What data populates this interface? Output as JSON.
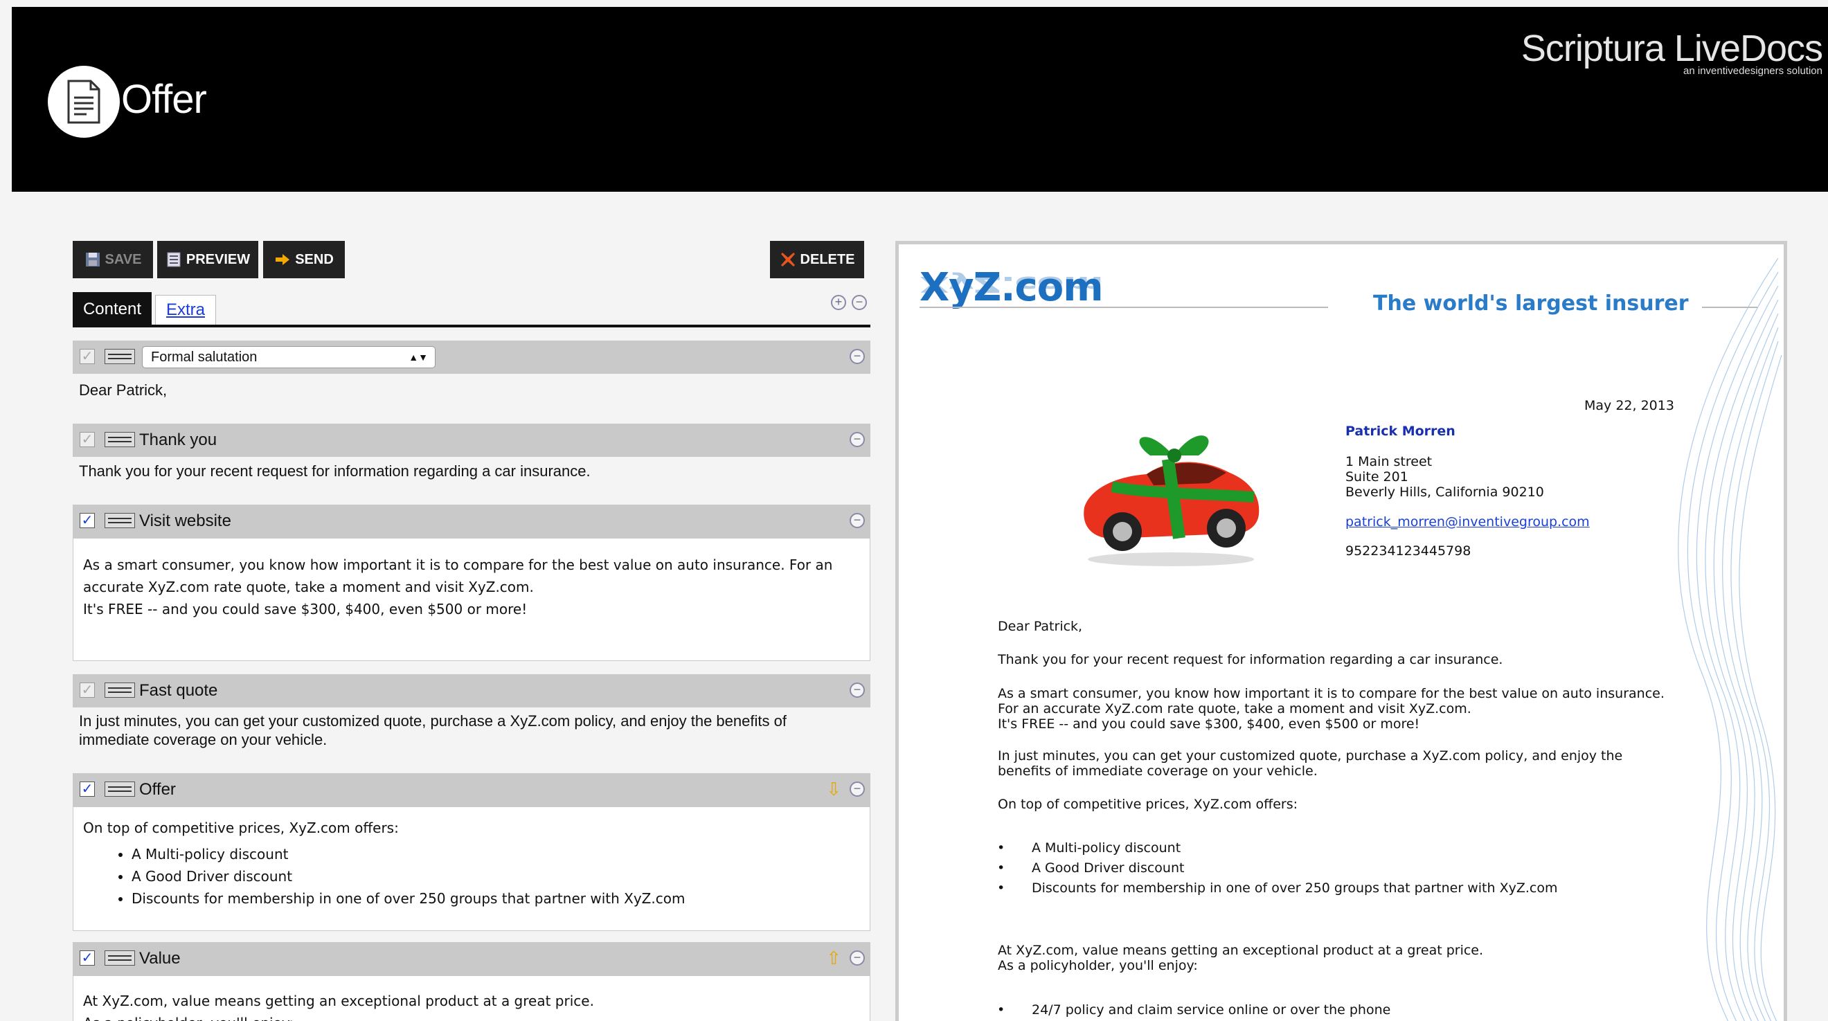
{
  "header": {
    "app_title": "Offer",
    "brand_name": "Scriptura LiveDocs",
    "brand_sub": "an inventivedesigners solution"
  },
  "toolbar": {
    "save": "SAVE",
    "preview": "PREVIEW",
    "send": "SEND",
    "delete": "DELETE"
  },
  "tabs": {
    "content": "Content",
    "extra": "Extra"
  },
  "sections": {
    "salutation": {
      "select_value": "Formal salutation",
      "text": "Dear Patrick,"
    },
    "thank_you": {
      "title": "Thank you",
      "text": "Thank you for your recent request for information regarding a car insurance."
    },
    "visit_website": {
      "title": "Visit website",
      "line1": "As a smart consumer, you know how important it is to compare for the best value on auto insurance. For an",
      "line2": "accurate XyZ.com rate quote, take a moment and visit XyZ.com.",
      "line3": "It's FREE -- and you could save $300, $400, even $500 or more!"
    },
    "fast_quote": {
      "title": "Fast quote",
      "line1": "In just minutes, you can get your customized quote, purchase a XyZ.com policy, and enjoy the benefits of",
      "line2": "immediate coverage on your vehicle."
    },
    "offer": {
      "title": "Offer",
      "intro": "On top of competitive prices, XyZ.com offers:",
      "items": [
        "A Multi-policy discount",
        "A Good Driver discount",
        "Discounts for membership in one of over 250 groups that partner with XyZ.com"
      ]
    },
    "value": {
      "title": "Value",
      "line1": "At XyZ.com, value means getting an exceptional product at a great price.",
      "line2": "As a policyholder, you'll enjoy:"
    }
  },
  "preview": {
    "logo": "XyZ.com",
    "slogan": "The world's largest insurer",
    "date": "May 22, 2013",
    "name": "Patrick Morren",
    "address1": "1 Main street",
    "address2": "Suite 201",
    "address3": "Beverly Hills, California  90210",
    "email": "patrick_morren@inventivegroup.com",
    "phone": "952234123445798",
    "salutation": "Dear Patrick,",
    "thank_you": "Thank you for your recent request for information regarding a car insurance.",
    "visit1": "As a smart consumer, you know how important it is to compare for the best value on auto insurance.",
    "visit2": "For an accurate XyZ.com rate quote, take a moment and visit XyZ.com.",
    "visit3": "It's FREE -- and you could save $300, $400, even $500 or more!",
    "quote1": "In just minutes, you can get your customized quote, purchase a XyZ.com policy, and enjoy the",
    "quote2": "benefits of immediate coverage on your vehicle.",
    "offer_intro": "On top of competitive prices, XyZ.com offers:",
    "offer_items": [
      "A Multi-policy discount",
      "A Good Driver discount",
      "Discounts for membership in one of over 250 groups that partner with XyZ.com"
    ],
    "value1": "At XyZ.com, value means getting an exceptional product at a great price.",
    "value2": "As a policyholder, you'll enjoy:",
    "value_item": "24/7 policy and claim service online or over the phone"
  },
  "colors": {
    "header_bg": "#000000",
    "accent_blue": "#1a3fd6",
    "logo_blue": "#1d6fc0",
    "section_bar": "#c9c9c9"
  }
}
